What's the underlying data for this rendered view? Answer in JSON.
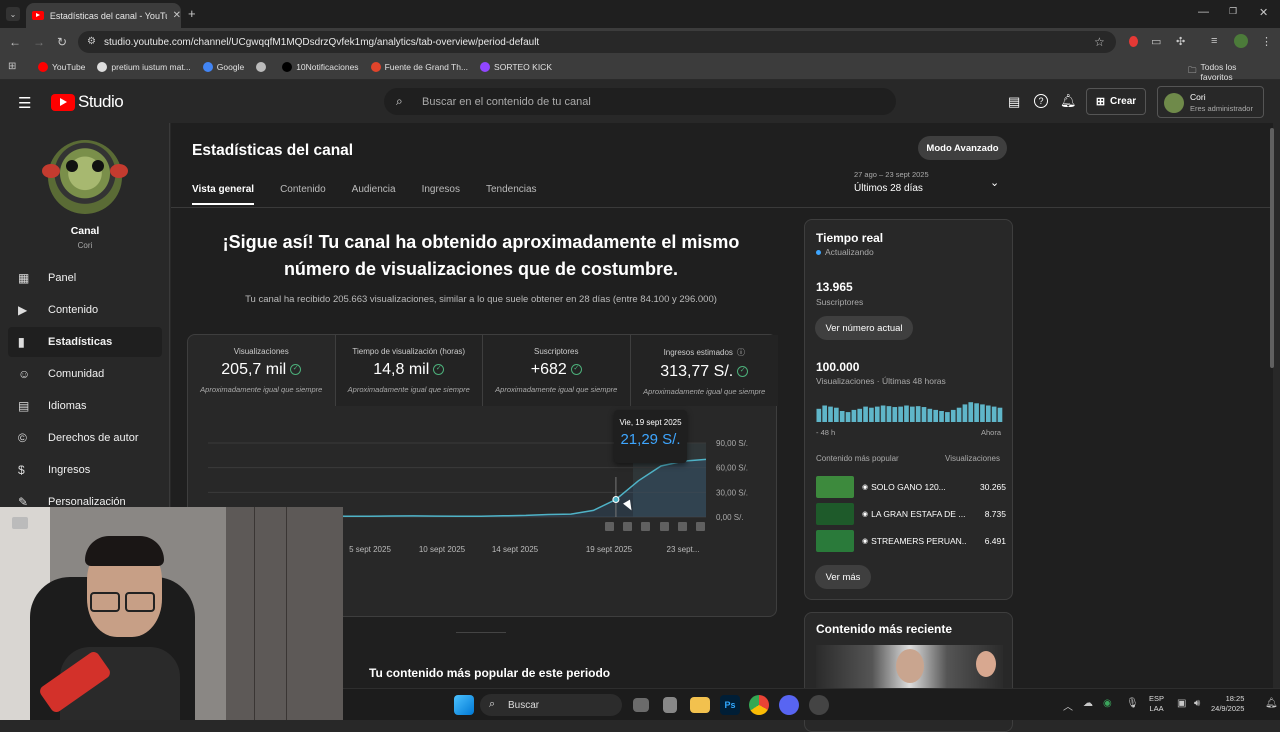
{
  "browser": {
    "tab_title": "Estadísticas del canal - YouTube",
    "url": "studio.youtube.com/channel/UCgwqqfM1MQDsdrzQvfek1mg/analytics/tab-overview/period-default",
    "bookmarks": [
      {
        "label": "YouTube",
        "color": "#ff0000"
      },
      {
        "label": "pretium iustum mat...",
        "color": "#dddddd"
      },
      {
        "label": "Google",
        "color": "#4285f4"
      },
      {
        "label": "",
        "color": "#bbbbbb"
      },
      {
        "label": "10Notificaciones",
        "color": "#000000"
      },
      {
        "label": "Fuente de Grand Th...",
        "color": "#e0442b"
      },
      {
        "label": "SORTEO KICK",
        "color": "#9146ff"
      }
    ],
    "all_bookmarks": "Todos los favoritos"
  },
  "studio": {
    "logo": "Studio",
    "search_placeholder": "Buscar en el contenido de tu canal",
    "create_label": "Crear",
    "user_name": "Cori",
    "user_role": "Eres administrador"
  },
  "sidebar": {
    "channel_label": "Canal",
    "channel_name": "Cori",
    "items": [
      {
        "label": "Panel",
        "icon": "grid-icon",
        "active": false
      },
      {
        "label": "Contenido",
        "icon": "content-icon",
        "active": false
      },
      {
        "label": "Estadísticas",
        "icon": "analytics-icon",
        "active": true
      },
      {
        "label": "Comunidad",
        "icon": "community-icon",
        "active": false
      },
      {
        "label": "Idiomas",
        "icon": "subtitles-icon",
        "active": false
      },
      {
        "label": "Derechos de autor",
        "icon": "copyright-icon",
        "active": false
      },
      {
        "label": "Ingresos",
        "icon": "dollar-icon",
        "active": false
      },
      {
        "label": "Personalización",
        "icon": "wand-icon",
        "active": false
      }
    ]
  },
  "page": {
    "title": "Estadísticas del canal",
    "advanced_mode": "Modo Avanzado",
    "tabs": [
      "Vista general",
      "Contenido",
      "Audiencia",
      "Ingresos",
      "Tendencias"
    ],
    "active_tab": "Vista general",
    "date_range": "27 ago – 23 sept 2025",
    "period": "Últimos 28 días",
    "headline": "¡Sigue así! Tu canal ha obtenido aproximadamente el mismo número de visualizaciones que de costumbre.",
    "subline": "Tu canal ha recibido 205.663 visualizaciones, similar a lo que suele obtener en 28 días (entre 84.100 y 296.000)",
    "popular_heading": "Tu contenido más popular de este periodo"
  },
  "kpis": [
    {
      "title": "Visualizaciones",
      "value": "205,7 mil",
      "sub": "Aproximadamente igual que siempre"
    },
    {
      "title": "Tiempo de visualización (horas)",
      "value": "14,8 mil",
      "sub": "Aproximadamente igual que siempre"
    },
    {
      "title": "Suscriptores",
      "value": "+682",
      "sub": "Aproximadamente igual que siempre"
    },
    {
      "title": "Ingresos estimados",
      "value": "313,77 S/.",
      "sub": "Aproximadamente igual que siempre"
    }
  ],
  "chart_data": {
    "type": "line",
    "title": "",
    "series": [
      {
        "values": [
          1.0,
          2.5,
          3.0,
          2.0,
          1.0,
          3.0,
          1.5,
          1.0,
          1.0,
          1.2,
          1.3,
          1.1,
          1.0,
          1.0,
          1.5,
          2.0,
          3.0,
          3.5,
          8.0,
          21.29,
          44.0,
          62.0,
          68.0,
          70.0
        ]
      }
    ],
    "x_ticks": [
      "5 sept 2025",
      "10 sept 2025",
      "14 sept 2025",
      "19 sept 2025",
      "23 sept..."
    ],
    "y_ticks": [
      "90,00 S/.",
      "60,00 S/.",
      "30,00 S/.",
      "0,00 S/."
    ],
    "ylim": [
      0,
      90
    ],
    "tooltip_date": "Vie, 19 sept 2025",
    "tooltip_value": "21,29 S/.",
    "marker_labels": [
      "",
      ""
    ]
  },
  "realtime": {
    "title": "Tiempo real",
    "status": "Actualizando",
    "subs_value": "13.965",
    "subs_label": "Suscriptores",
    "subs_button": "Ver número actual",
    "views_value": "100.000",
    "views_label": "Visualizaciones · Últimas 48 horas",
    "axis_left": "- 48 h",
    "axis_right": "Ahora",
    "bars": [
      60,
      75,
      70,
      65,
      50,
      45,
      55,
      60,
      70,
      65,
      70,
      75,
      72,
      68,
      70,
      75,
      70,
      72,
      68,
      60,
      55,
      50,
      45,
      55,
      65,
      80,
      90,
      85,
      80,
      75,
      70,
      65
    ],
    "popular_label": "Contenido más popular",
    "views_col": "Visualizaciones",
    "top": [
      {
        "title": "SOLO GANO 120...",
        "views": "30.265",
        "thumb": "#3d8a3d"
      },
      {
        "title": "LA GRAN ESTAFA DE ...",
        "views": "8.735",
        "thumb": "#1e5a2a"
      },
      {
        "title": "STREAMERS PERUAN...",
        "views": "6.491",
        "thumb": "#2a7a3a"
      }
    ],
    "more": "Ver más"
  },
  "recent": {
    "title": "Contenido más reciente"
  },
  "taskbar": {
    "search": "Buscar",
    "lang1": "ESP",
    "lang2": "LAA",
    "time": "18:25",
    "date": "24/9/2025"
  }
}
